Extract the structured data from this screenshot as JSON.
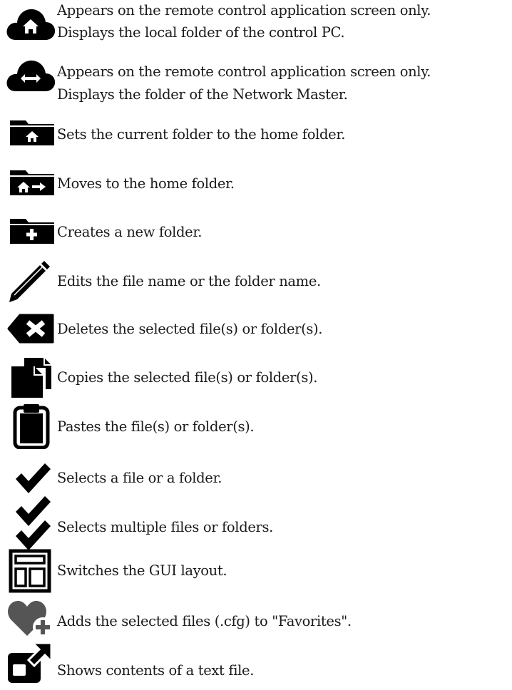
{
  "items": [
    {
      "icon": "cloud-home-icon",
      "lines": [
        "Appears on the remote control application screen only.",
        "Displays the local folder of the control PC."
      ]
    },
    {
      "icon": "cloud-arrows-icon",
      "lines": [
        "Appears on the remote control application screen only.",
        "Displays the folder of the Network Master."
      ]
    },
    {
      "icon": "folder-home-icon",
      "lines": [
        "Sets the current folder to the home folder."
      ]
    },
    {
      "icon": "folder-home-arrow-icon",
      "lines": [
        "Moves to the home folder."
      ]
    },
    {
      "icon": "folder-plus-icon",
      "lines": [
        "Creates a new folder."
      ]
    },
    {
      "icon": "pencil-icon",
      "lines": [
        "Edits the file name or the folder name."
      ]
    },
    {
      "icon": "backspace-delete-icon",
      "lines": [
        "Deletes the selected file(s) or folder(s)."
      ]
    },
    {
      "icon": "copy-files-icon",
      "lines": [
        "Copies the selected file(s) or folder(s)."
      ]
    },
    {
      "icon": "clipboard-icon",
      "lines": [
        "Pastes the file(s) or folder(s)."
      ]
    },
    {
      "icon": "checkmark-icon",
      "lines": [
        "Selects a file or a folder."
      ]
    },
    {
      "icon": "double-checkmark-icon",
      "lines": [
        "Selects multiple files or folders."
      ]
    },
    {
      "icon": "layout-icon",
      "lines": [
        "Switches the GUI layout."
      ]
    },
    {
      "icon": "heart-plus-icon",
      "lines": [
        "Adds the selected files (.cfg) to \"Favorites\"."
      ]
    },
    {
      "icon": "open-external-icon",
      "lines": [
        "Shows contents of a text file."
      ]
    }
  ]
}
